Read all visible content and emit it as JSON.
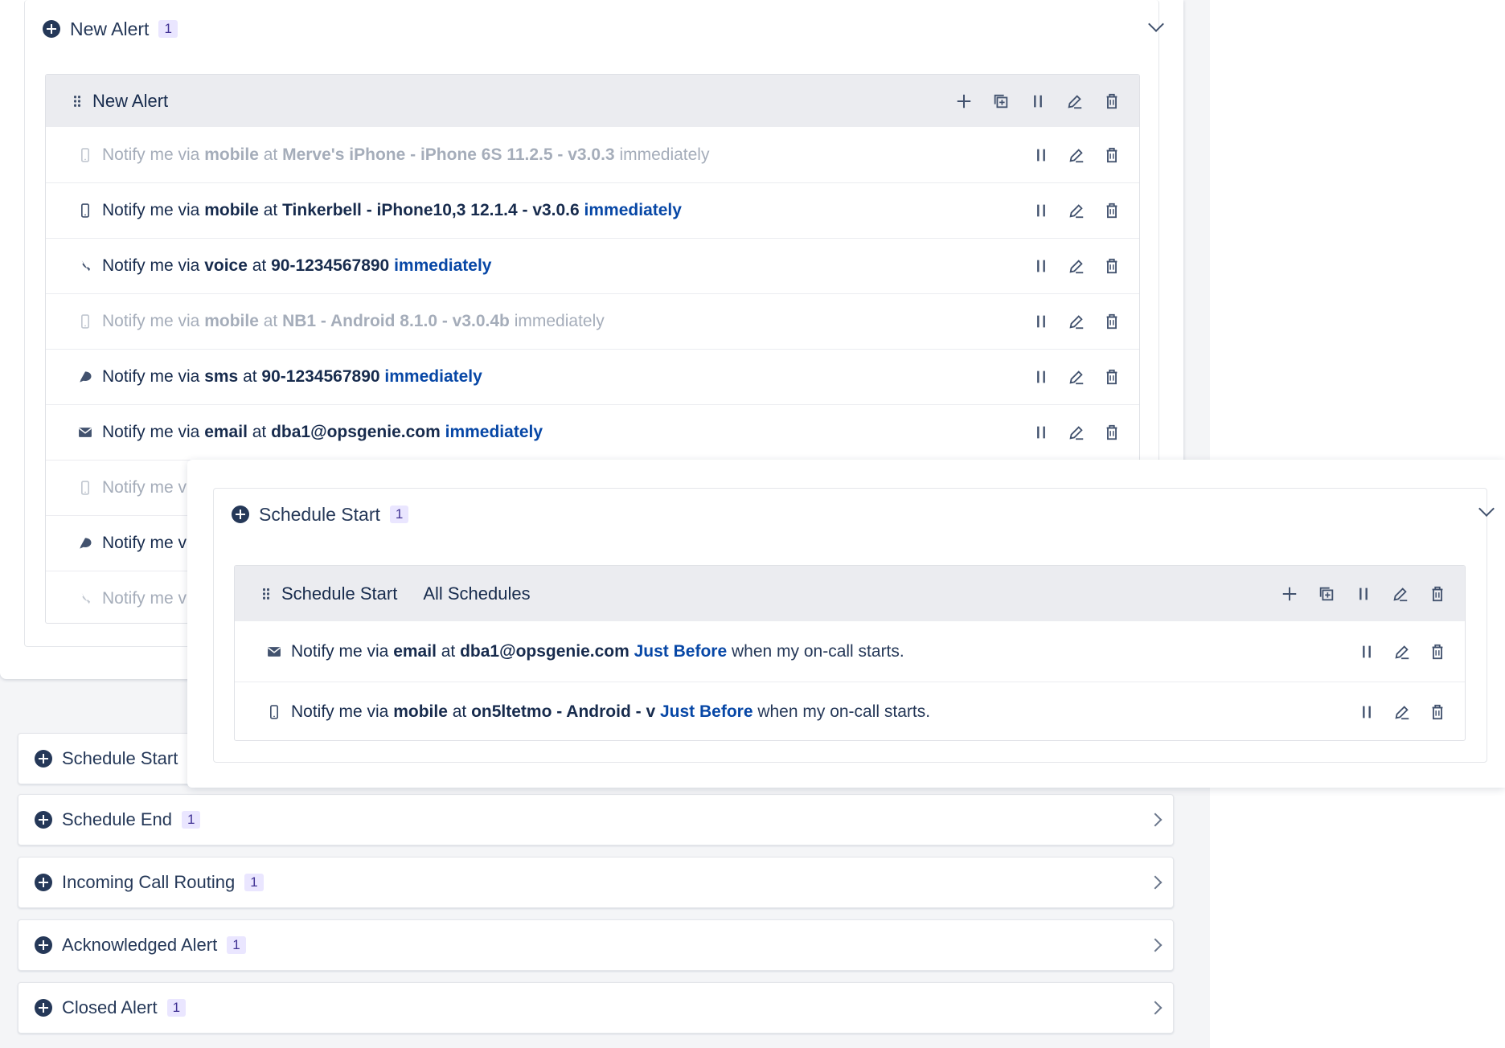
{
  "new_alert": {
    "title": "New Alert",
    "count": "1",
    "group_title": "New Alert",
    "rules": [
      {
        "channel": "mobile",
        "icon": "mobile-icon",
        "prefix": "Notify me via ",
        "via": "mobile",
        "at": " at ",
        "target": "Merve's iPhone - iPhone 6S 11.2.5 - v3.0.3",
        "timing": "immediately",
        "disabled": true
      },
      {
        "channel": "mobile",
        "icon": "mobile-icon",
        "prefix": "Notify me via ",
        "via": "mobile",
        "at": " at ",
        "target": "Tinkerbell - iPhone10,3 12.1.4 - v3.0.6",
        "timing": "immediately",
        "disabled": false
      },
      {
        "channel": "voice",
        "icon": "phone-icon",
        "prefix": "Notify me via ",
        "via": "voice",
        "at": " at ",
        "target": "90-1234567890",
        "timing": "immediately",
        "disabled": false
      },
      {
        "channel": "mobile",
        "icon": "mobile-icon",
        "prefix": "Notify me via ",
        "via": "mobile",
        "at": " at ",
        "target": "NB1 - Android 8.1.0 - v3.0.4b",
        "timing": "immediately",
        "disabled": true
      },
      {
        "channel": "sms",
        "icon": "chat-bubble-icon",
        "prefix": "Notify me via ",
        "via": "sms",
        "at": " at ",
        "target": "90-1234567890",
        "timing": "immediately",
        "disabled": false
      },
      {
        "channel": "email",
        "icon": "envelope-icon",
        "prefix": "Notify me via ",
        "via": "email",
        "at": " at ",
        "target": "dba1@opsgenie.com",
        "timing": "immediately",
        "disabled": false
      },
      {
        "channel": "mobile",
        "icon": "mobile-icon",
        "prefix": "Notify me v",
        "via": "",
        "at": "",
        "target": "",
        "timing": "",
        "disabled": true
      },
      {
        "channel": "sms",
        "icon": "chat-bubble-icon",
        "prefix": "Notify me v",
        "via": "",
        "at": "",
        "target": "",
        "timing": "",
        "disabled": false
      },
      {
        "channel": "voice",
        "icon": "phone-icon",
        "prefix": "Notify me v",
        "via": "",
        "at": "",
        "target": "",
        "timing": "",
        "disabled": true
      }
    ]
  },
  "schedule_start_overlay": {
    "title": "Schedule Start",
    "count": "1",
    "group_title": "Schedule Start",
    "group_extra": "All Schedules",
    "rules": [
      {
        "icon": "envelope-icon",
        "prefix": "Notify me via ",
        "via": "email",
        "at": " at ",
        "target": "dba1@opsgenie.com",
        "timing": "Just Before",
        "tail": " when my on-call starts."
      },
      {
        "icon": "mobile-icon",
        "prefix": "Notify me via ",
        "via": "mobile",
        "at": " at ",
        "target": "on5ltetmo - Android - v",
        "timing": "Just Before",
        "tail": " when my on-call starts."
      }
    ]
  },
  "collapsed_sections": [
    {
      "title": "Schedule Start",
      "count": ""
    },
    {
      "title": "Schedule End",
      "count": "1"
    },
    {
      "title": "Incoming Call Routing",
      "count": "1"
    },
    {
      "title": "Acknowledged Alert",
      "count": "1"
    },
    {
      "title": "Closed Alert",
      "count": "1"
    }
  ],
  "colors": {
    "accent": "#0747a6",
    "badge_bg": "#eae6ff",
    "disabled_text": "#a5adba"
  }
}
